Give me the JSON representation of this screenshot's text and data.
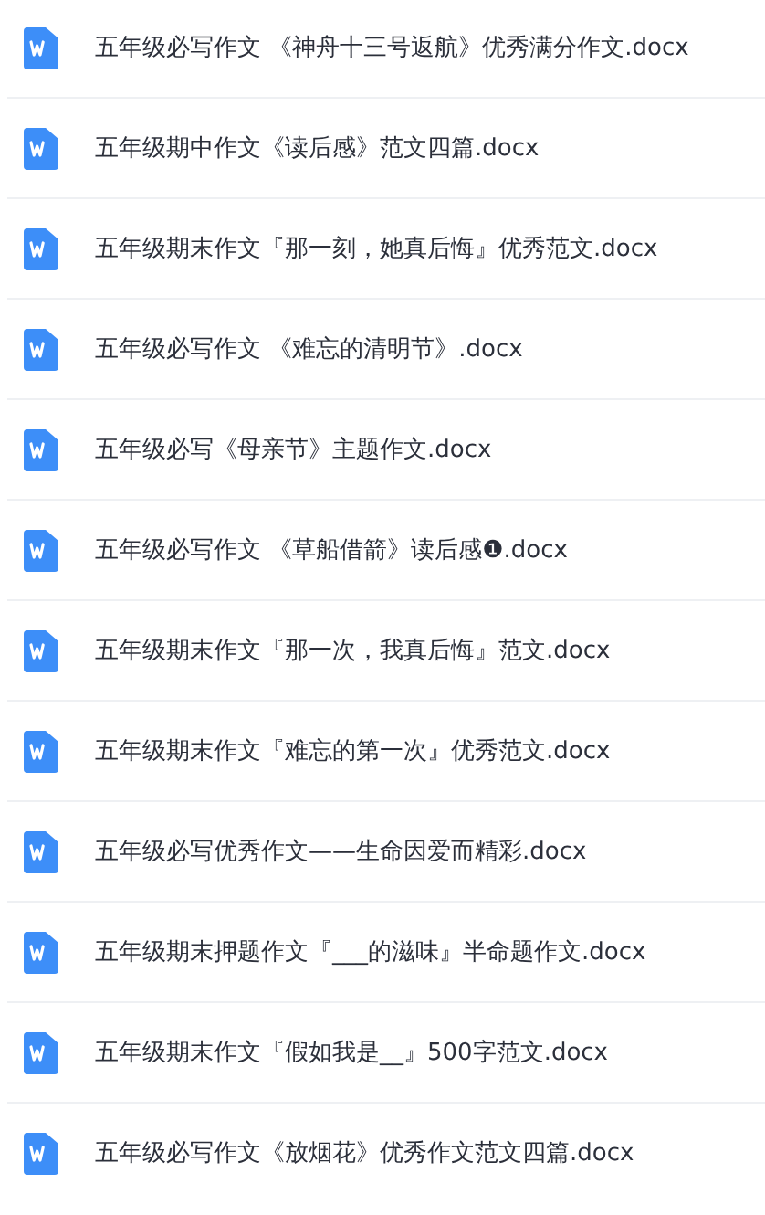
{
  "files": [
    {
      "name": "五年级必写作文 《神舟十三号返航》优秀满分作文.docx"
    },
    {
      "name": "五年级期中作文《读后感》范文四篇.docx"
    },
    {
      "name": "五年级期末作文『那一刻，她真后悔』优秀范文.docx"
    },
    {
      "name": "五年级必写作文 《难忘的清明节》.docx"
    },
    {
      "name": "五年级必写《母亲节》主题作文.docx"
    },
    {
      "name": "五年级必写作文 《草船借箭》读后感❶.docx"
    },
    {
      "name": "五年级期末作文『那一次，我真后悔』范文.docx"
    },
    {
      "name": "五年级期末作文『难忘的第一次』优秀范文.docx"
    },
    {
      "name": "五年级必写优秀作文——生命因爱而精彩.docx"
    },
    {
      "name": "五年级期末押题作文『___的滋味』半命题作文.docx"
    },
    {
      "name": "五年级期末作文『假如我是__』500字范文.docx"
    },
    {
      "name": "五年级必写作文《放烟花》优秀作文范文四篇.docx"
    }
  ]
}
